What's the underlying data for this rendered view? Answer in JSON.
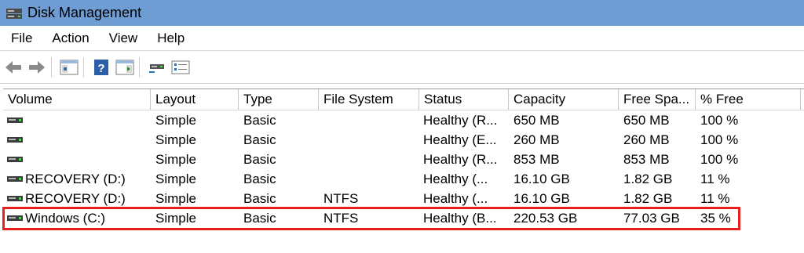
{
  "window": {
    "title": "Disk Management",
    "app_icon": "disk-management-icon"
  },
  "menu": [
    "File",
    "Action",
    "View",
    "Help"
  ],
  "toolbar": [
    {
      "name": "back-arrow-icon"
    },
    {
      "name": "forward-arrow-icon"
    },
    {
      "name": "show-hide-console-tree-icon"
    },
    {
      "name": "help-icon"
    },
    {
      "name": "show-hide-action-pane-icon"
    },
    {
      "name": "connect-disk-icon"
    },
    {
      "name": "properties-list-icon"
    }
  ],
  "columns": [
    "Volume",
    "Layout",
    "Type",
    "File System",
    "Status",
    "Capacity",
    "Free Spa...",
    "% Free"
  ],
  "rows": [
    {
      "volume": "",
      "layout": "Simple",
      "type": "Basic",
      "fs": "",
      "status": "Healthy (R...",
      "capacity": "650 MB",
      "free": "650 MB",
      "pct": "100 %"
    },
    {
      "volume": "",
      "layout": "Simple",
      "type": "Basic",
      "fs": "",
      "status": "Healthy (E...",
      "capacity": "260 MB",
      "free": "260 MB",
      "pct": "100 %"
    },
    {
      "volume": "",
      "layout": "Simple",
      "type": "Basic",
      "fs": "",
      "status": "Healthy (R...",
      "capacity": "853 MB",
      "free": "853 MB",
      "pct": "100 %"
    },
    {
      "volume": "RECOVERY (D:)",
      "layout": "Simple",
      "type": "Basic",
      "fs": "",
      "status": "Healthy (...",
      "capacity": "16.10 GB",
      "free": "1.82 GB",
      "pct": "11 %"
    },
    {
      "volume": "RECOVERY (D:)",
      "layout": "Simple",
      "type": "Basic",
      "fs": "NTFS",
      "status": "Healthy (...",
      "capacity": "16.10 GB",
      "free": "1.82 GB",
      "pct": "11 %"
    },
    {
      "volume": "Windows (C:)",
      "layout": "Simple",
      "type": "Basic",
      "fs": "NTFS",
      "status": "Healthy (B...",
      "capacity": "220.53 GB",
      "free": "77.03 GB",
      "pct": "35 %"
    }
  ],
  "highlight_color": "#e8201c",
  "titlebar_color": "#6f9cd3"
}
